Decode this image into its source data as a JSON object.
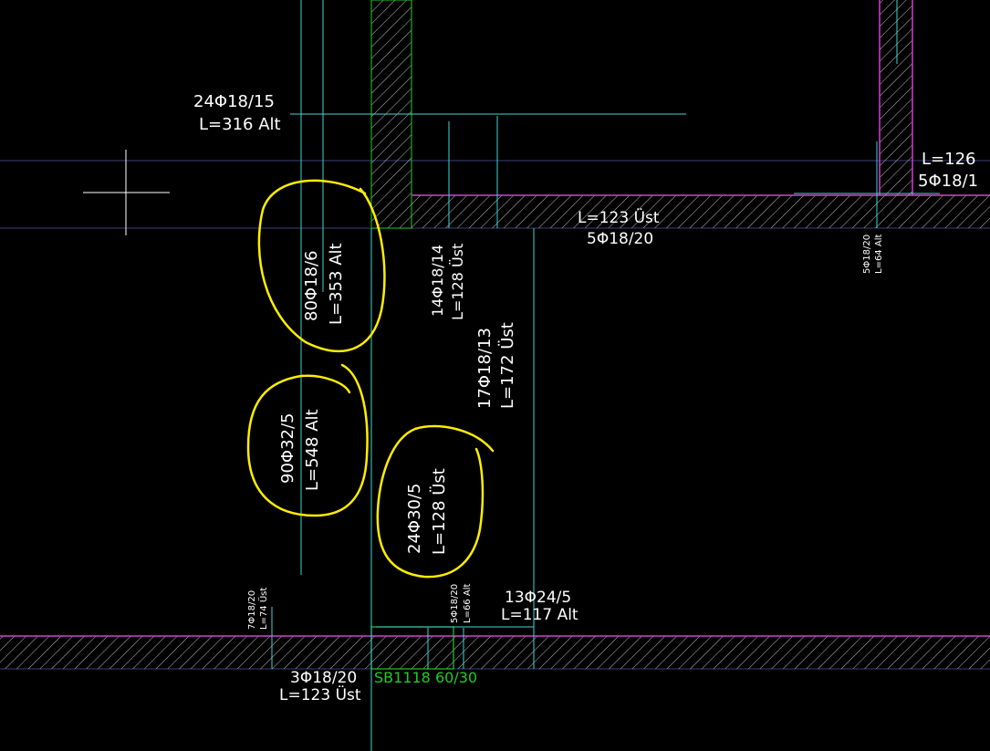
{
  "colors": {
    "background": "#000000",
    "rebar_line": "#3fd6d6",
    "wall_outline": "#d43fd4",
    "hatch": "#bfbfbf",
    "column_outline": "#22cc22",
    "grid_line": "#3a3f7a",
    "annotation_marker": "#ffee00",
    "text": "#ffffff",
    "beam_label": "#22cc22"
  },
  "cursor": {
    "icon": "crosshair-icon"
  },
  "labels": {
    "top_left_count": "24Φ18/15",
    "top_left_len": "L=316 Alt",
    "right_top_len": "L=126",
    "right_top_count": "5Φ18/1",
    "mid_beam_len": "L=123 Üst",
    "mid_beam_count": "5Φ18/20",
    "right_small_count": "5Φ18/20",
    "right_small_len": "L=64 Alt",
    "circled_1_count": "80Φ18/6",
    "circled_1_len": "L=353 Alt",
    "v14_count": "14Φ18/14",
    "v14_len": "L=128 Üst",
    "v17_count": "17Φ18/13",
    "v17_len": "L=172 Üst",
    "circled_2_count": "90Φ32/5",
    "circled_2_len": "L=548 Alt",
    "circled_3_count": "24Φ30/5",
    "circled_3_len": "L=128 Üst",
    "left_small_count": "7Φ18/20",
    "left_small_len": "L=74 Üst",
    "mid_small_count": "5Φ18/20",
    "mid_small_len": "L=66 Alt",
    "bottom_right_count": "13Φ24/5",
    "bottom_right_len": "L=117 Alt",
    "bottom_left_count": "3Φ18/20",
    "bottom_left_len": "L=123 Üst",
    "beam_tag": "SB1118 60/30"
  }
}
